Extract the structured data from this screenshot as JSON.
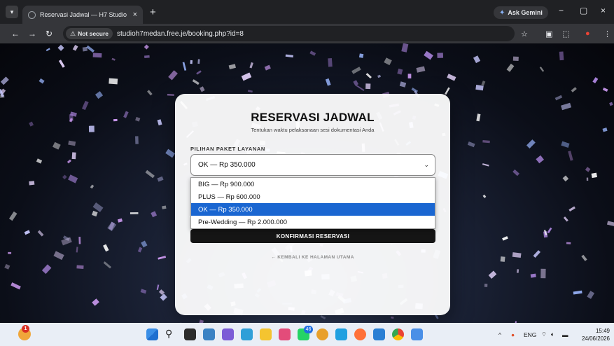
{
  "browser": {
    "tab_title": "Reservasi Jadwal — H7 Studio",
    "tab_close": "×",
    "new_tab": "+",
    "ask_gemini": "Ask Gemini",
    "security_label": "Not secure",
    "url": "studioh7medan.free.je/booking.php?id=8",
    "window_controls": [
      "−",
      "▢",
      "×"
    ]
  },
  "card": {
    "title": "RESERVASI JADWAL",
    "subtitle": "Tentukan waktu pelaksanaan sesi dokumentasi Anda",
    "package_label": "PILIHAN PAKET LAYANAN",
    "selected_value": "OK — Rp 350.000",
    "options": [
      {
        "label": "BIG — Rp 900.000",
        "selected": false
      },
      {
        "label": "PLUS — Rp 600.000",
        "selected": false
      },
      {
        "label": "OK — Rp 350.000",
        "selected": true
      },
      {
        "label": "Pre-Wedding — Rp 2.000.000",
        "selected": false
      }
    ],
    "confirm_button": "KONFIRMASI RESERVASI",
    "back_link": "← KEMBALI KE HALAMAN UTAMA"
  },
  "taskbar": {
    "language": "ENG",
    "time": "15:49",
    "date": "24/06/2026",
    "notification_badge": "1",
    "whatsapp_badge": "46"
  },
  "colors": {
    "selected_option": "#1a66d1",
    "confirm_button": "#151515",
    "chrome_dark": "#202124"
  }
}
